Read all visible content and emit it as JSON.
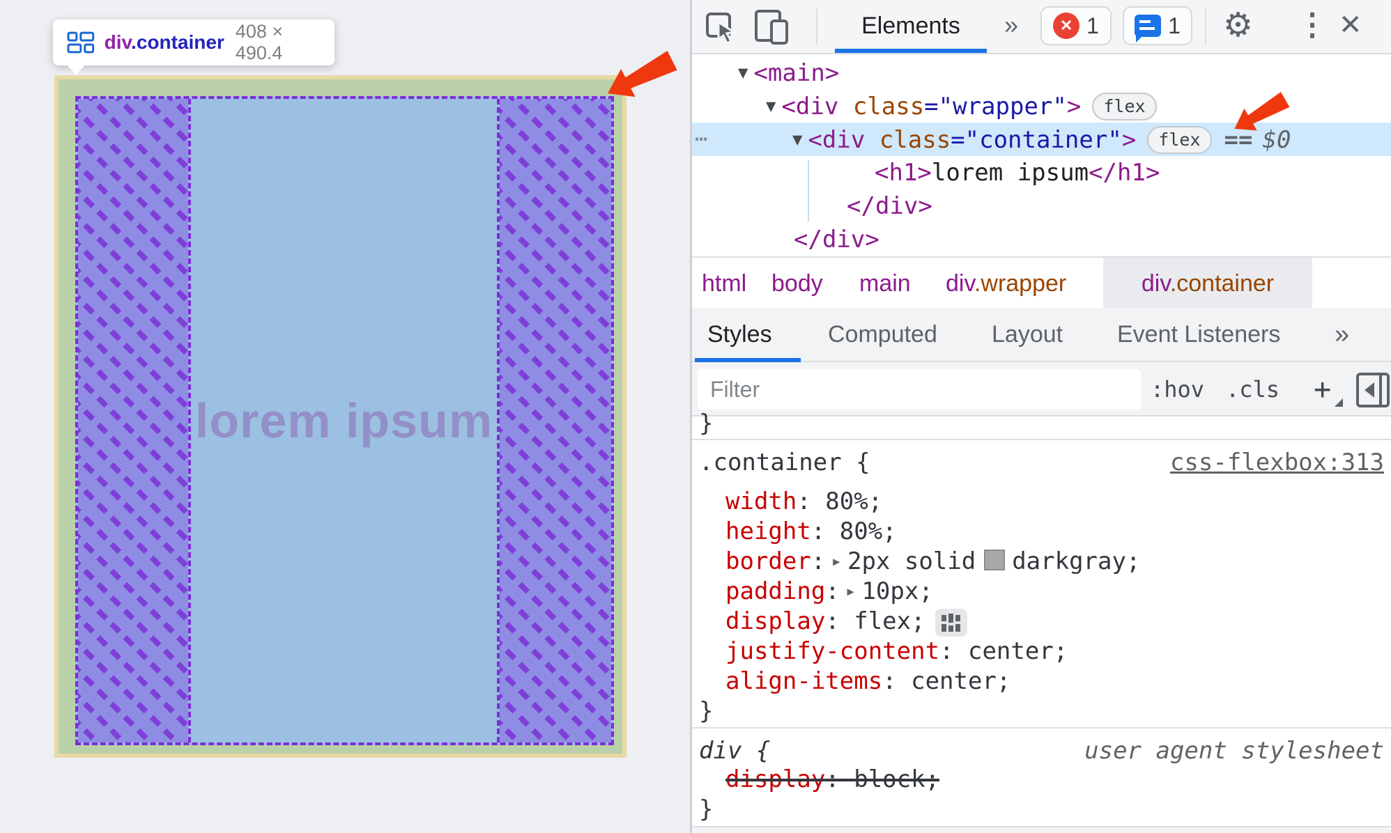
{
  "overlay": {
    "heading": "lorem ipsum"
  },
  "tooltip": {
    "tag": "div",
    "cls": ".container",
    "dims": "408 × 490.4"
  },
  "toolbar": {
    "tab": "Elements",
    "more": "»",
    "error_count": "1",
    "message_count": "1"
  },
  "icons": {
    "disclosure": "▼",
    "expand_arrow": "▸",
    "gutter_dots": "⋯",
    "gear": "⚙",
    "kebab": "⋮",
    "close": "✕",
    "error_x": "✕"
  },
  "dom": {
    "main_open": "<main>",
    "wrapper": {
      "pre": "<div ",
      "attr": "class",
      "val": "=\"wrapper\"",
      "post": ">",
      "badge": "flex"
    },
    "container": {
      "pre": "<div ",
      "attr": "class",
      "val": "=\"container\"",
      "post": ">",
      "badge": "flex",
      "assign": "==",
      "dollar": "$0"
    },
    "h1": {
      "open": "<h1>",
      "text": "lorem ipsum",
      "close": "</h1>"
    },
    "close_inner": "</div>",
    "close_outer": "</div>"
  },
  "breadcrumbs": {
    "items": [
      {
        "tag": "html",
        "cls": ""
      },
      {
        "tag": "body",
        "cls": ""
      },
      {
        "tag": "main",
        "cls": ""
      },
      {
        "tag": "div",
        "cls": ".wrapper"
      },
      {
        "tag": "div",
        "cls": ".container"
      }
    ]
  },
  "tabs": [
    "Styles",
    "Computed",
    "Layout",
    "Event Listeners",
    "»"
  ],
  "filter": {
    "placeholder": "Filter",
    "hov": ":hov",
    "cls": ".cls",
    "plus": "+"
  },
  "styles": {
    "prev_close": "}",
    "rule1": {
      "selector": ".container {",
      "link": "css-flexbox:313",
      "close": "}",
      "props": [
        {
          "name": "width",
          "value": ": 80%;"
        },
        {
          "name": "height",
          "value": ": 80%;"
        },
        {
          "name": "border",
          "pre": ":",
          "v1": "2px solid",
          "v2": "darkgray;"
        },
        {
          "name": "padding",
          "pre": ":",
          "value": "10px;"
        },
        {
          "name": "display",
          "value": ": flex;"
        },
        {
          "name": "justify-content",
          "value": ": center;"
        },
        {
          "name": "align-items",
          "value": ": center;"
        }
      ]
    },
    "rule2": {
      "selector": "div {",
      "origin": "user agent stylesheet",
      "prop_name": "display",
      "prop_value": ": block;",
      "close": "}"
    }
  },
  "colors": {
    "accent_blue": "#1a73e8",
    "error_red": "#e94235",
    "selection_blue": "#cfe8fc",
    "overlay_border": "#e8d9a4",
    "overlay_padding": "#bad0a8",
    "overlay_content": "#9cc0e1",
    "overlay_hatch_bg": "#8f8de3",
    "overlay_hatch_line": "#7e3fd8",
    "overlay_dashed_border": "#7d2dd7",
    "annotation_arrow_red": "#f0380f",
    "heading_text": "#928fc9"
  }
}
